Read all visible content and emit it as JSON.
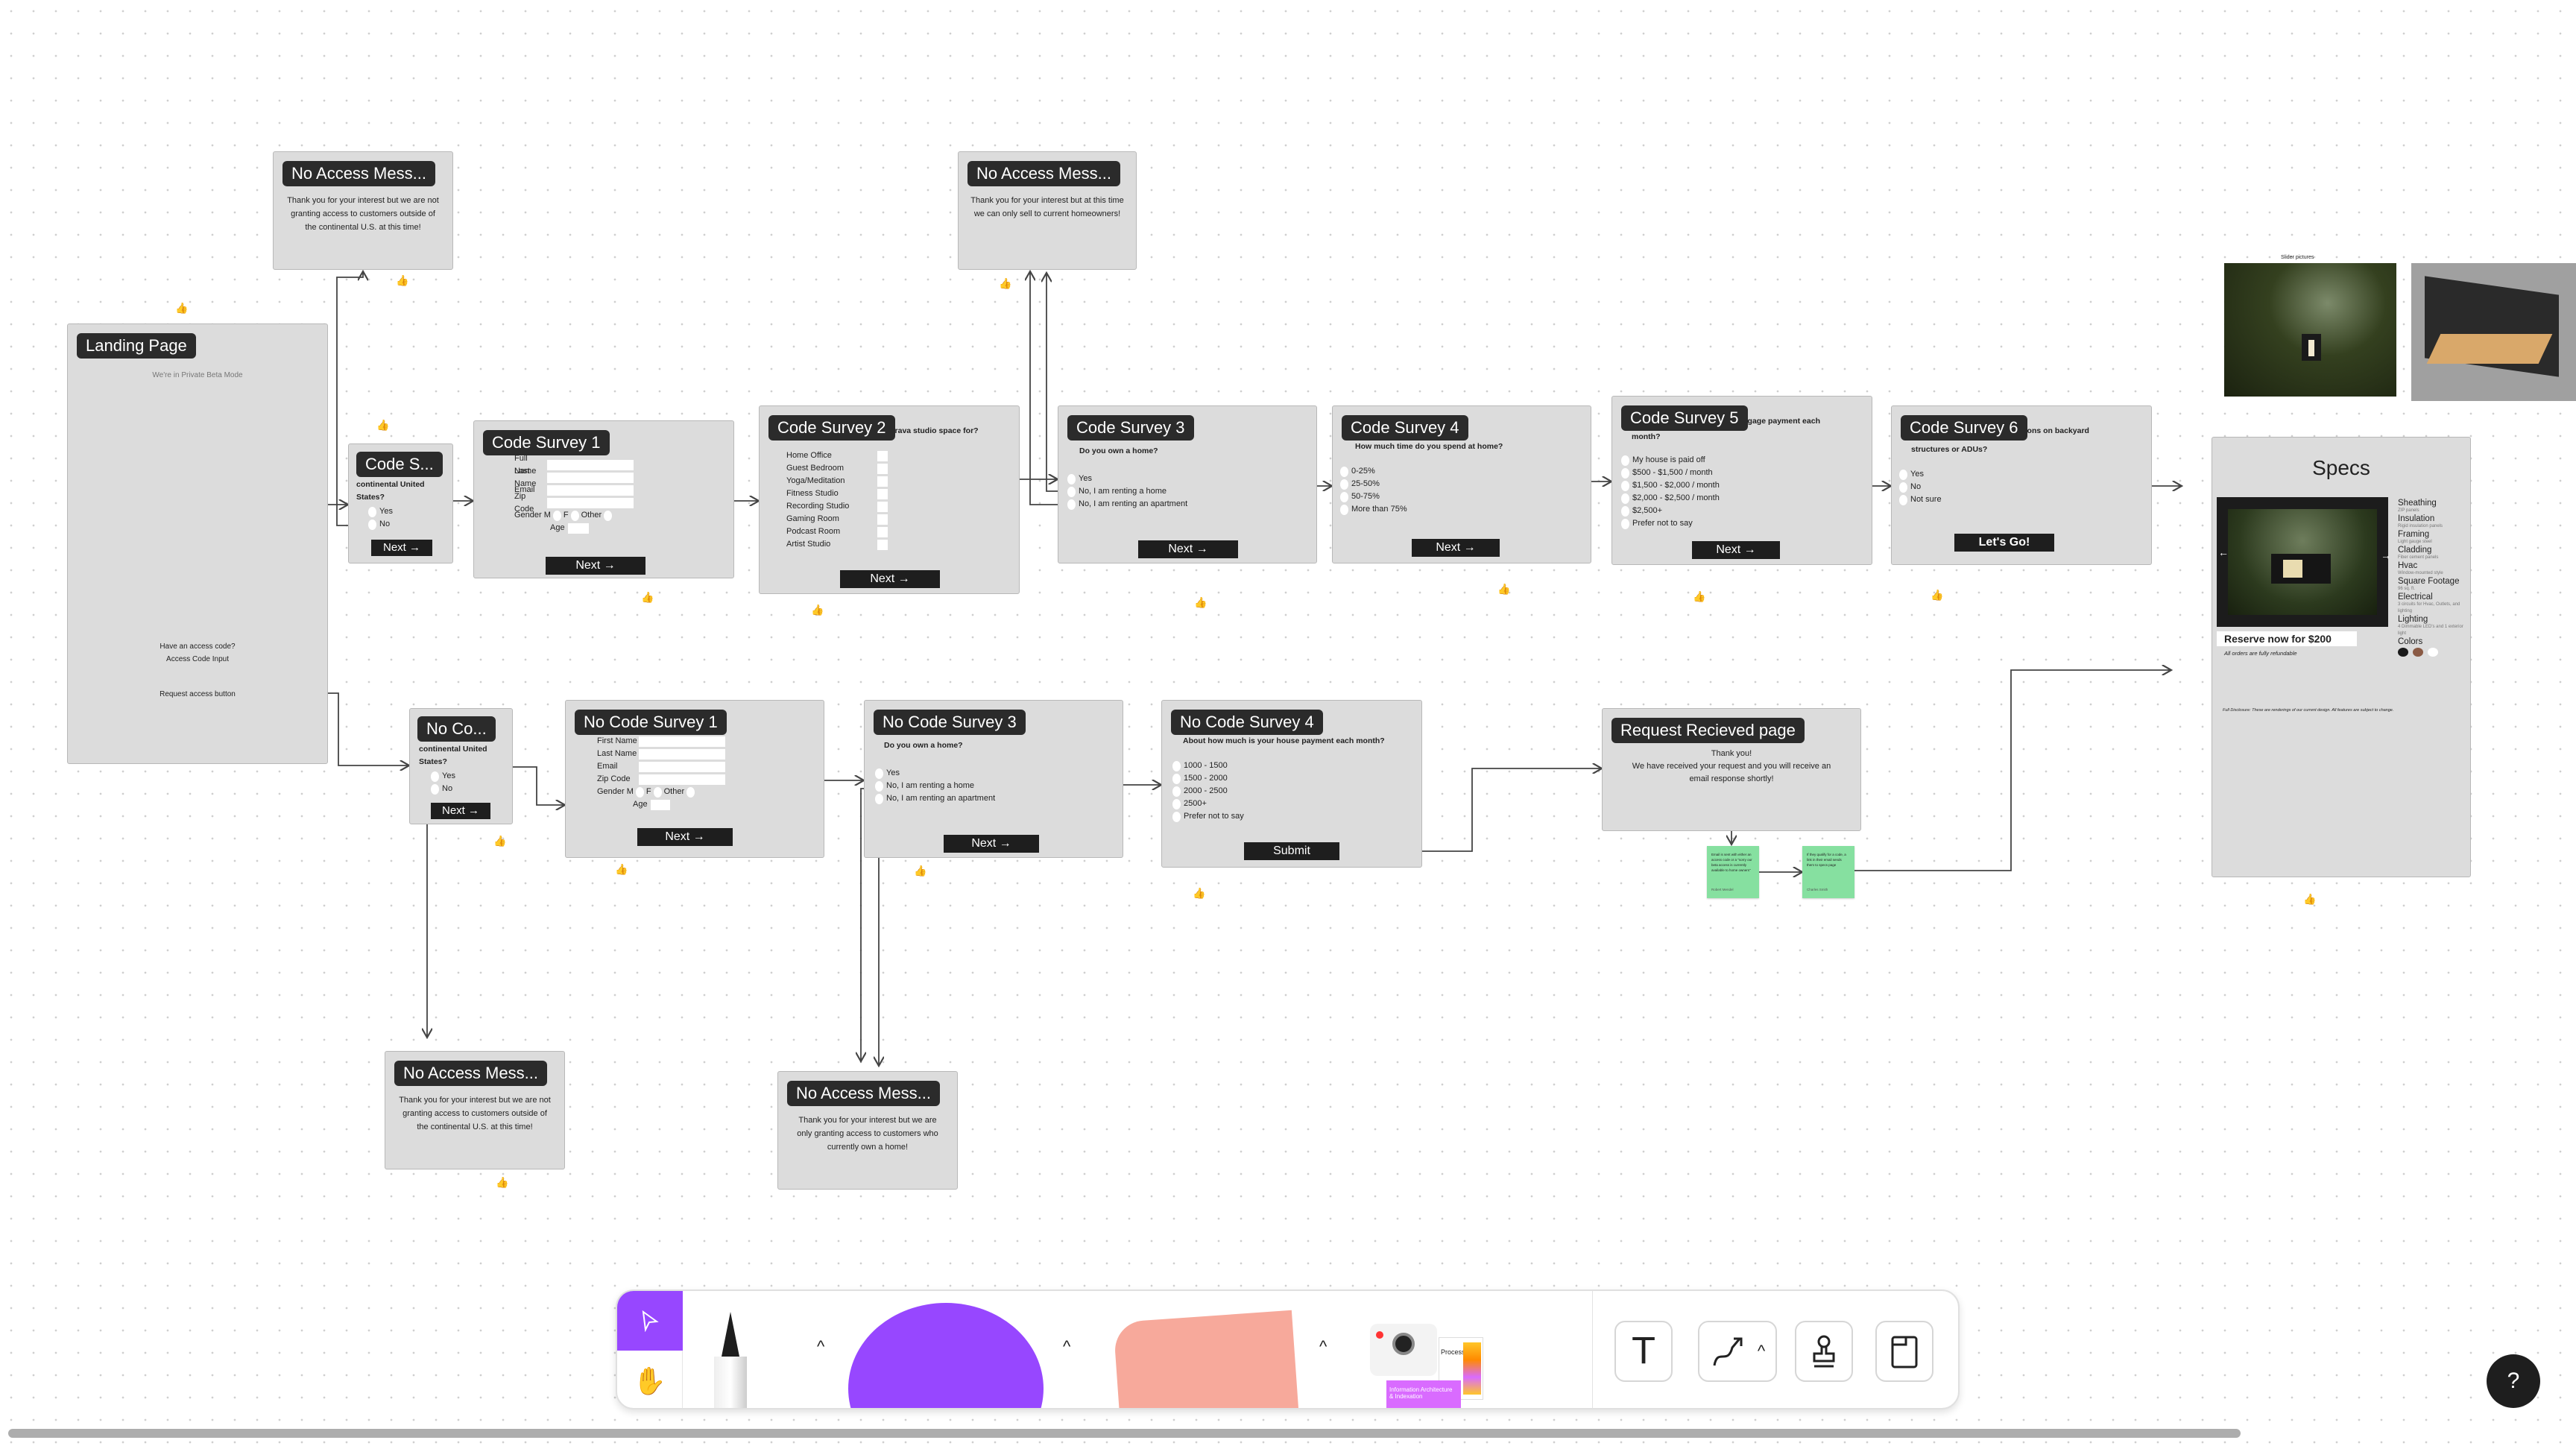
{
  "landing": {
    "title": "Landing Page",
    "subtitle": "We're in Private Beta Mode",
    "access_code_q": "Have an access code?",
    "access_code_input": "Access Code Input",
    "request_btn": "Request access button"
  },
  "no_access_1": {
    "title": "No Access Mess...",
    "text": "Thank you for your interest but we are not granting access to customers outside of the continental U.S. at this time!"
  },
  "no_access_2": {
    "title": "No Access Mess...",
    "text": "Thank you for your interest but at this time we can only sell to current homeowners!"
  },
  "no_access_3": {
    "title": "No Access Mess...",
    "text": "Thank you for your interest but we are not granting access to customers outside of the continental U.S. at this time!"
  },
  "no_access_4": {
    "title": "No Access Mess...",
    "text": "Thank you for your interest but we are only granting access to customers who currently own a home!"
  },
  "code_s": {
    "title": "Code S...",
    "question": "continental United States?",
    "options": [
      "Yes",
      "No"
    ],
    "next": "Next →"
  },
  "code_survey_1": {
    "title": "Code Survey 1",
    "fields": [
      "Full Name",
      "Last Name",
      "Email",
      "Zip Code"
    ],
    "gender_label": "Gender",
    "gender_options": [
      "M",
      "F",
      "Other"
    ],
    "age_label": "Age",
    "next": "Next →"
  },
  "code_survey_2": {
    "title": "Code Survey 2",
    "question": "rava studio space for?",
    "options": [
      "Home Office",
      "Guest Bedroom",
      "Yoga/Meditation",
      "Fitness Studio",
      "Recording Studio",
      "Gaming Room",
      "Podcast Room",
      "Artist Studio"
    ],
    "next": "Next →"
  },
  "code_survey_3": {
    "title": "Code Survey 3",
    "question": "Do you own a home?",
    "options": [
      "Yes",
      "No, I am renting a home",
      "No, I am renting an apartment"
    ],
    "next": "Next →"
  },
  "code_survey_4": {
    "title": "Code Survey 4",
    "question": "How much time do you spend at home?",
    "options": [
      "0-25%",
      "25-50%",
      "50-75%",
      "More than 75%"
    ],
    "next": "Next →"
  },
  "code_survey_5": {
    "title": "Code Survey 5",
    "question_tail": "gage payment each",
    "question_line2": "month?",
    "options": [
      "My house is paid off",
      "$500 - $1,500 / month",
      "$1,500 - $2,000 / month",
      "$2,000 - $2,500 / month",
      "$2,500+",
      "Prefer not to say"
    ],
    "next": "Next →"
  },
  "code_survey_6": {
    "title": "Code Survey 6",
    "question_tail": "ons on backyard",
    "question_line2": "structures or ADUs?",
    "options": [
      "Yes",
      "No",
      "Not sure"
    ],
    "cta": "Let's Go!"
  },
  "slider": {
    "label": "Slider pictures"
  },
  "specs": {
    "title": "Specs",
    "reserve": "Reserve now for $200",
    "refund": "All orders are fully refundable",
    "disclosure": "Full Disclosure: These are renderings of our current design. All features are subject to change.",
    "items": [
      {
        "h": "Sheathing",
        "s": "ZIP panels"
      },
      {
        "h": "Insulation",
        "s": "Rigid insulation panels"
      },
      {
        "h": "Framing",
        "s": "Light gauge steel"
      },
      {
        "h": "Cladding",
        "s": "Fiber cement panels"
      },
      {
        "h": "Hvac",
        "s": "Window-mounted style"
      },
      {
        "h": "Square Footage",
        "s": "96 sq. ft."
      },
      {
        "h": "Electrical",
        "s": "3 circuits for Hvac, Outlets, and lighting"
      },
      {
        "h": "Lighting",
        "s": "4 Dimmable LED's and 1 exterior light"
      }
    ],
    "colors_label": "Colors",
    "colors": [
      "#1a1a1a",
      "#8a5a44",
      "#ffffff"
    ]
  },
  "no_co": {
    "title": "No Co...",
    "question": "continental United States?",
    "options": [
      "Yes",
      "No"
    ],
    "next": "Next →"
  },
  "no_code_survey_1": {
    "title": "No Code Survey 1",
    "fields": [
      "First Name",
      "Last Name",
      "Email",
      "Zip Code"
    ],
    "gender_label": "Gender",
    "gender_options": [
      "M",
      "F",
      "Other"
    ],
    "age_label": "Age",
    "next": "Next →"
  },
  "no_code_survey_3": {
    "title": "No Code Survey 3",
    "question": "Do you own a home?",
    "options": [
      "Yes",
      "No, I am renting a home",
      "No, I am renting an apartment"
    ],
    "next": "Next →"
  },
  "no_code_survey_4": {
    "title": "No Code Survey 4",
    "question": "About how much is your house payment each month?",
    "options": [
      "1000 - 1500",
      "1500 - 2000",
      "2000 - 2500",
      "2500+",
      "Prefer not to say"
    ],
    "submit": "Submit"
  },
  "request_received": {
    "title": "Request Recieved page",
    "line1": "Thank you!",
    "line2": "We have received your request and you will receive an email response shortly!"
  },
  "stickies": [
    {
      "text": "Email is sent with either an access code or a \"sorry our beta access is currently available to home owners\"",
      "author": "Robert Mendel"
    },
    {
      "text": "If they qualify for a code, a link in their email sends them to specs page",
      "author": "Charles Smith"
    }
  ],
  "toolbar": {
    "accent": "#9747ff",
    "tools": [
      "select-tool",
      "hand-tool",
      "pen-tool",
      "shape-tool",
      "sticky-note-tool",
      "stickers-templates",
      "text-tool",
      "connector-tool",
      "stamp-tool",
      "frame-tool"
    ],
    "template_1": "Process Map",
    "template_2": "Information Architecture & Indexation"
  },
  "help": {
    "label": "?"
  }
}
